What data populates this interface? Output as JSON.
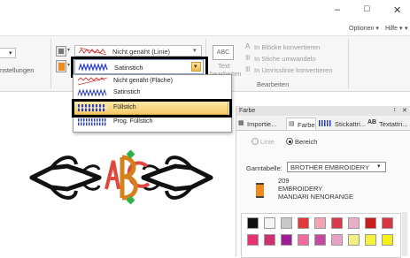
{
  "window": {
    "minimize_glyph": "–",
    "maximize_glyph": "□",
    "close_glyph": "✕"
  },
  "menu": {
    "options": "Optionen",
    "help": "Hilfe",
    "options_arrow": "▾",
    "help_arrow": "▾",
    "help_extra": "▾"
  },
  "ribbon": {
    "left_partial_label": "nstellungen",
    "left_arrow": "▾",
    "line_stitch_value": "Nicht genäht (Linie)",
    "fill_stitch_value": "Satinstich",
    "text_button_icon": "ABC",
    "text_button_label_1": "Text",
    "text_button_label_2": "bearbeiten",
    "cmd_blocks": "In Blöcke konvertieren",
    "cmd_stitches": "In Stiche umwandeln",
    "cmd_outline": "In Umrisslinie konvertieren",
    "group_label": "Bearbeiten",
    "line_arrow": "▾",
    "fill_arrow": "▾"
  },
  "dropdown": {
    "items": [
      {
        "label": "Nicht genäht (Fläche)"
      },
      {
        "label": "Satinstich"
      },
      {
        "label": "Füllstich"
      },
      {
        "label": "Prog. Füllstich"
      }
    ]
  },
  "panel": {
    "title": "Farbe",
    "pin": "↕",
    "close": "✕",
    "tabs": [
      {
        "label": "Importie..."
      },
      {
        "label": "Farbe"
      },
      {
        "label": "Stickattri..."
      },
      {
        "label": "Textattri..."
      }
    ],
    "radio_line": "Linie",
    "radio_area": "Bereich",
    "table_label": "Garntabelle:",
    "table_value": "BROTHER EMBROIDERY",
    "table_arrow": "▾",
    "color_code": "209",
    "color_brand": "EMBROIDERY",
    "color_name": "MANDARI NENORANGE",
    "current_color": "#f08a1e",
    "swatches_row1": [
      "#111111",
      "#f4f4f4",
      "#c8c8c8",
      "#e23a3a",
      "#f2a3b4",
      "#d43c4c",
      "#e8b0c8",
      "#c91d1d",
      "#d4373f"
    ],
    "swatches_row2": [
      "#e8316e",
      "#cc3070",
      "#9e1d96",
      "#f06aa0",
      "#c24aa0",
      "#e8a0c4",
      "#f2f080",
      "#f4f23c",
      "#f4f014"
    ]
  }
}
